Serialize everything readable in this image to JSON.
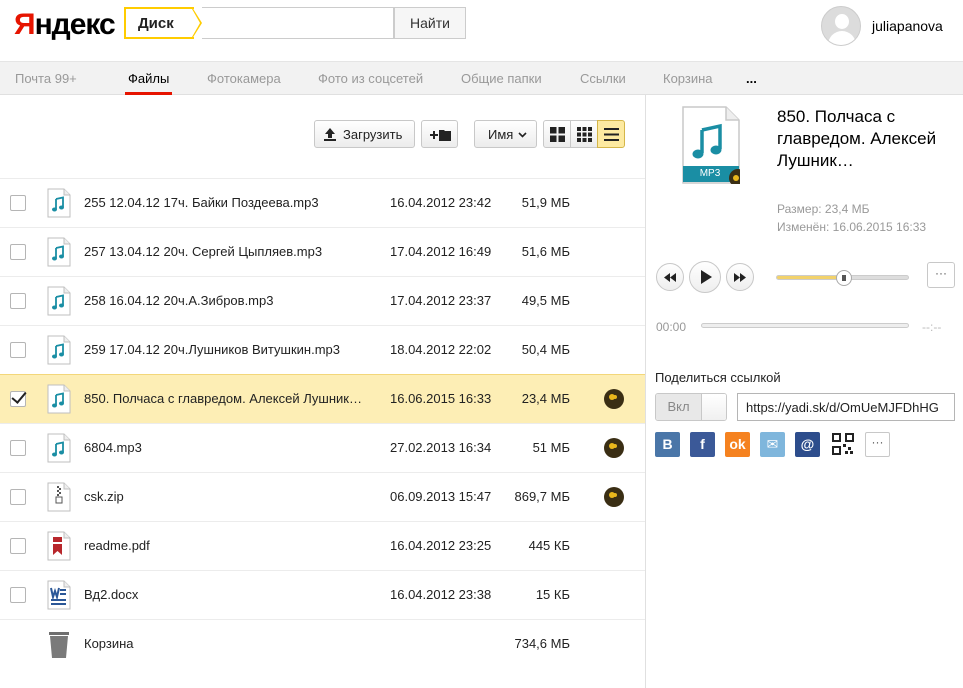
{
  "header": {
    "logo": "Яндекс",
    "logo_first_letter": "Я",
    "logo_rest": "ндекс",
    "service_tag": "Диск",
    "search_placeholder": "",
    "search_button": "Найти",
    "username": "juliapanova"
  },
  "nav": {
    "items": [
      {
        "label": "Почта 99+",
        "active": false
      },
      {
        "label": "Файлы",
        "active": true
      },
      {
        "label": "Фотокамера",
        "active": false
      },
      {
        "label": "Фото из соцсетей",
        "active": false
      },
      {
        "label": "Общие папки",
        "active": false
      },
      {
        "label": "Ссылки",
        "active": false
      },
      {
        "label": "Корзина",
        "active": false
      },
      {
        "label": "...",
        "active": false
      }
    ],
    "active_color": "#e61400"
  },
  "toolbar": {
    "upload_label": "Загрузить",
    "sort_label": "Имя",
    "active_view": "list"
  },
  "files": [
    {
      "name": "255 12.04.12 17ч. Байки Поздеева.mp3",
      "date": "16.04.2012 23:42",
      "size": "51,9 МБ",
      "type": "mp3",
      "shared": false,
      "selected": false
    },
    {
      "name": "257 13.04.12 20ч. Сергей Цыпляев.mp3",
      "date": "17.04.2012 16:49",
      "size": "51,6 МБ",
      "type": "mp3",
      "shared": false,
      "selected": false
    },
    {
      "name": "258 16.04.12 20ч.А.Зибров.mp3",
      "date": "17.04.2012 23:37",
      "size": "49,5 МБ",
      "type": "mp3",
      "shared": false,
      "selected": false
    },
    {
      "name": "259 17.04.12 20ч.Лушников Витушкин.mp3",
      "date": "18.04.2012 22:02",
      "size": "50,4 МБ",
      "type": "mp3",
      "shared": false,
      "selected": false
    },
    {
      "name": "850. Полчаса с главредом. Алексей Лушник…",
      "date": "16.06.2015 16:33",
      "size": "23,4 МБ",
      "type": "mp3",
      "shared": true,
      "selected": true
    },
    {
      "name": "6804.mp3",
      "date": "27.02.2013 16:34",
      "size": "51 МБ",
      "type": "mp3",
      "shared": true,
      "selected": false
    },
    {
      "name": "csk.zip",
      "date": "06.09.2013 15:47",
      "size": "869,7 МБ",
      "type": "zip",
      "shared": true,
      "selected": false
    },
    {
      "name": "readme.pdf",
      "date": "16.04.2012 23:25",
      "size": "445 КБ",
      "type": "pdf",
      "shared": false,
      "selected": false
    },
    {
      "name": "Вд2.docx",
      "date": "16.04.2012 23:38",
      "size": "15 КБ",
      "type": "docx",
      "shared": false,
      "selected": false
    },
    {
      "name": "Корзина",
      "date": "",
      "size": "734,6 МБ",
      "type": "trash",
      "shared": false,
      "selected": false
    }
  ],
  "details": {
    "icon_label": "MP3",
    "title": "850. Полчаса с главредом. Алексей Лушник…",
    "size_line": "Размер: 23,4 МБ",
    "modified_line": "Изменён: 16.06.2015 16:33",
    "player": {
      "time_current": "00:00",
      "time_total": "--:--",
      "volume": 0.51,
      "progress": 0
    },
    "more_label": "···",
    "share": {
      "label": "Поделиться ссылкой",
      "toggle_label": "Вкл",
      "link": "https://yadi.sk/d/OmUeMJFDhHG"
    },
    "socials": [
      {
        "name": "vk",
        "glyph": "B",
        "color": "#4a76a8"
      },
      {
        "name": "facebook",
        "glyph": "f",
        "color": "#3b5998"
      },
      {
        "name": "odnoklassniki",
        "glyph": "ok",
        "color": "#f58220"
      },
      {
        "name": "mail",
        "glyph": "✉",
        "color": "#7fb6dc"
      },
      {
        "name": "mailru",
        "glyph": "@",
        "color": "#2d4d8c"
      },
      {
        "name": "qr",
        "glyph": "",
        "color": "#ffffff"
      }
    ],
    "socials_more": "···"
  },
  "colors": {
    "accent": "#ffcc00",
    "selected_row": "#fdeeb5",
    "mp3_icon": "#1a8ea4"
  }
}
